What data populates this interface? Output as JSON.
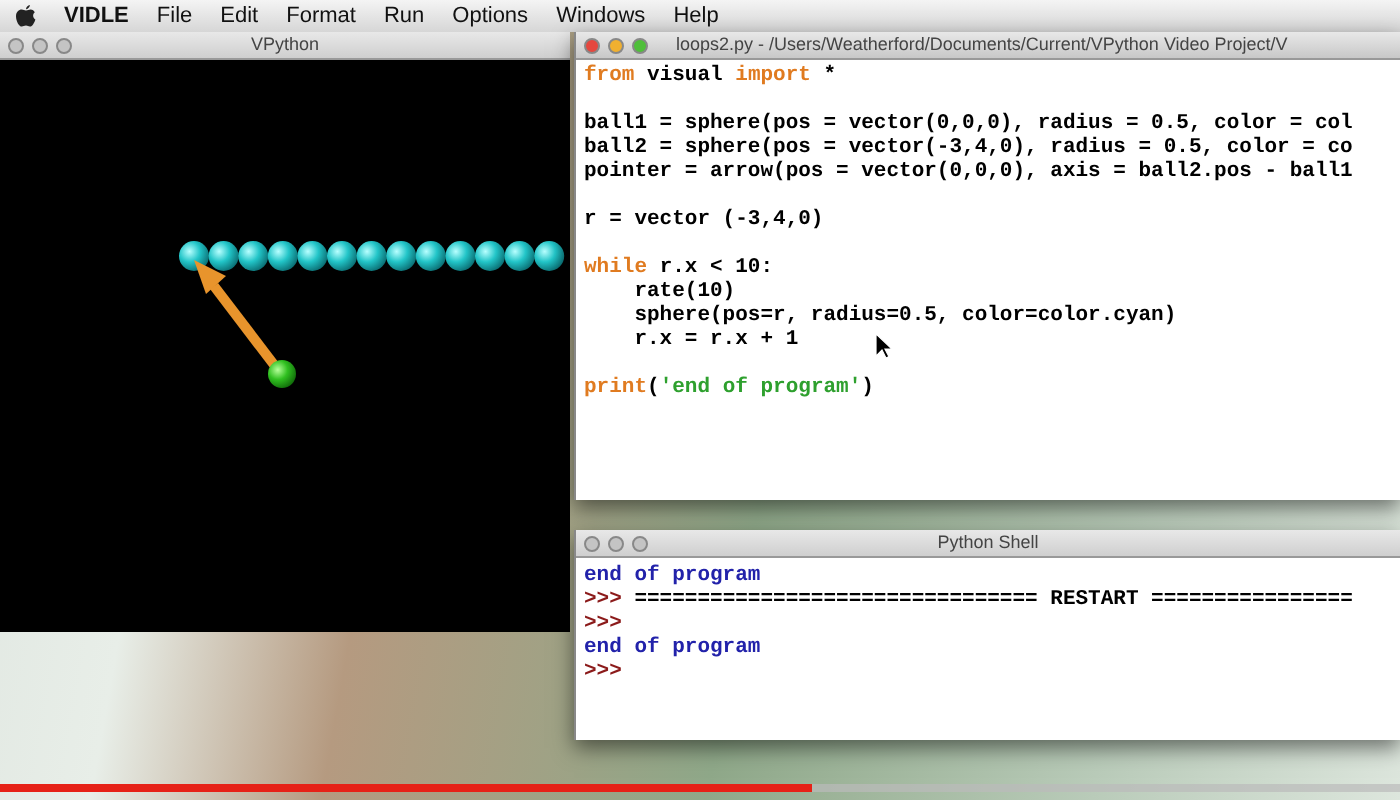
{
  "menu_bar": {
    "app_name": "VIDLE",
    "items": [
      "File",
      "Edit",
      "Format",
      "Run",
      "Options",
      "Windows",
      "Help"
    ]
  },
  "vpython_window": {
    "title": "VPython",
    "active": false
  },
  "editor_window": {
    "title": "loops2.py - /Users/Weatherford/Documents/Current/VPython Video Project/V",
    "active": true,
    "lines": [
      {
        "blank_before": false,
        "tokens": [
          {
            "kind": "keyword",
            "text": "from"
          },
          {
            "kind": "plain",
            "text": " visual "
          },
          {
            "kind": "keyword",
            "text": "import"
          },
          {
            "kind": "plain",
            "text": " *"
          }
        ]
      },
      {
        "blank_before": true,
        "tokens": [
          {
            "kind": "plain",
            "text": "ball1 = sphere(pos = vector(0,0,0), radius = 0.5, color = col"
          }
        ]
      },
      {
        "blank_before": false,
        "tokens": [
          {
            "kind": "plain",
            "text": "ball2 = sphere(pos = vector(-3,4,0), radius = 0.5, color = co"
          }
        ]
      },
      {
        "blank_before": false,
        "tokens": [
          {
            "kind": "plain",
            "text": "pointer = arrow(pos = vector(0,0,0), axis = ball2.pos - ball1"
          }
        ]
      },
      {
        "blank_before": true,
        "tokens": [
          {
            "kind": "plain",
            "text": "r = vector (-3,4,0)"
          }
        ]
      },
      {
        "blank_before": true,
        "tokens": [
          {
            "kind": "keyword",
            "text": "while"
          },
          {
            "kind": "plain",
            "text": " r.x < 10:"
          }
        ]
      },
      {
        "blank_before": false,
        "tokens": [
          {
            "kind": "plain",
            "text": "    rate(10)"
          }
        ]
      },
      {
        "blank_before": false,
        "tokens": [
          {
            "kind": "plain",
            "text": "    sphere(pos=r, radius=0.5, color=color.cyan)"
          }
        ]
      },
      {
        "blank_before": false,
        "tokens": [
          {
            "kind": "plain",
            "text": "    r.x = r.x + 1"
          }
        ]
      },
      {
        "blank_before": true,
        "tokens": [
          {
            "kind": "keyword",
            "text": "print"
          },
          {
            "kind": "plain",
            "text": "("
          },
          {
            "kind": "string",
            "text": "'end of program'"
          },
          {
            "kind": "plain",
            "text": ")"
          }
        ]
      }
    ]
  },
  "shell_window": {
    "title": "Python Shell",
    "active": false,
    "lines": [
      {
        "tokens": [
          {
            "kind": "output",
            "text": "end of program"
          }
        ]
      },
      {
        "tokens": [
          {
            "kind": "prompt",
            "text": ">>>"
          },
          {
            "kind": "plain",
            "text": " ================================ RESTART ================"
          }
        ]
      },
      {
        "tokens": [
          {
            "kind": "prompt",
            "text": ">>>"
          }
        ]
      },
      {
        "tokens": [
          {
            "kind": "output",
            "text": "end of program"
          }
        ]
      },
      {
        "tokens": [
          {
            "kind": "prompt",
            "text": ">>>"
          }
        ]
      }
    ]
  },
  "video_progress": {
    "level": 0.58
  }
}
